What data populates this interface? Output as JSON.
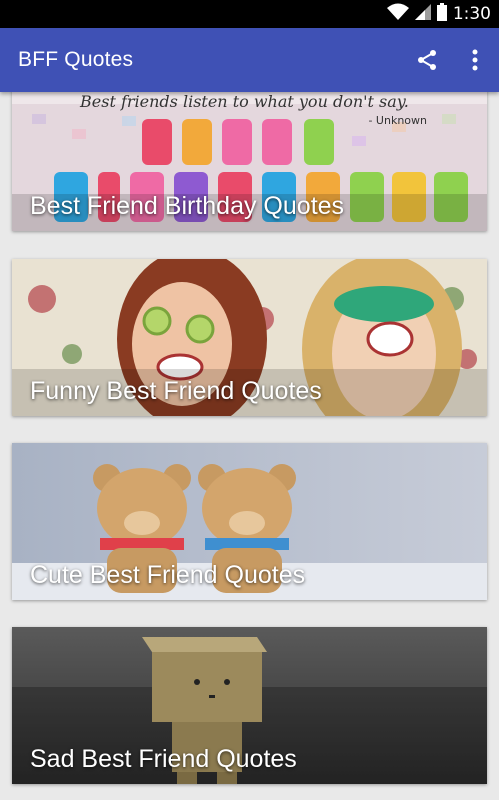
{
  "status_bar": {
    "time": "1:30",
    "icons": [
      "wifi-icon",
      "signal-icon",
      "battery-icon"
    ]
  },
  "app_bar": {
    "title": "BFF Quotes",
    "actions": [
      "share-icon",
      "more-vert-icon"
    ],
    "color": "#3f51b5"
  },
  "cards": [
    {
      "label": "Best Friend Birthday Quotes",
      "quote": "Best friends listen to what you don't say.",
      "quote_author": "- Unknown",
      "image": "happy-birthday-candles"
    },
    {
      "label": "Funny Best Friend Quotes",
      "image": "two-laughing-women"
    },
    {
      "label": "Cute Best Friend Quotes",
      "image": "two-teddy-bears"
    },
    {
      "label": "Sad Best Friend Quotes",
      "image": "sad-cardboard-figure"
    }
  ]
}
